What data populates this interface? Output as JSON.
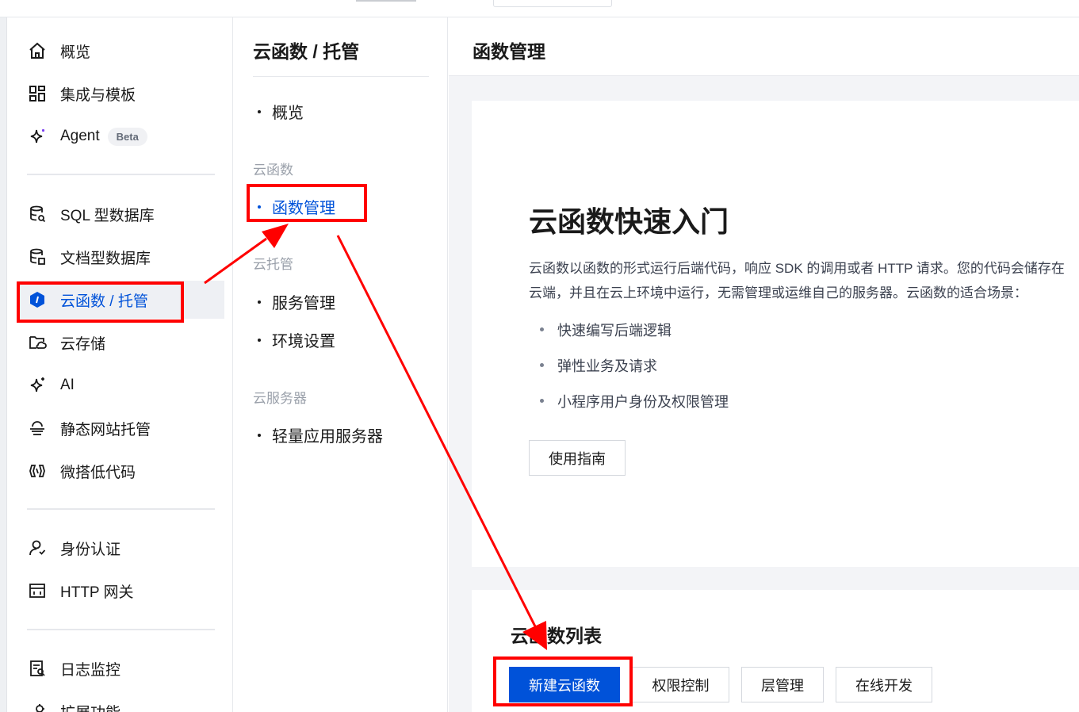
{
  "sidebar": {
    "items": [
      {
        "label": "概览",
        "icon": "home-icon"
      },
      {
        "label": "集成与模板",
        "icon": "grid-icon"
      },
      {
        "label": "Agent",
        "icon": "sparkle-icon",
        "badge": "Beta"
      },
      {
        "label": "SQL 型数据库",
        "icon": "sql-database-icon"
      },
      {
        "label": "文档型数据库",
        "icon": "document-database-icon"
      },
      {
        "label": "云函数 / 托管",
        "icon": "cloud-function-shield-icon",
        "active": true
      },
      {
        "label": "云存储",
        "icon": "cloud-storage-icon"
      },
      {
        "label": "AI",
        "icon": "ai-sparkle-icon"
      },
      {
        "label": "静态网站托管",
        "icon": "static-hosting-icon"
      },
      {
        "label": "微搭低代码",
        "icon": "lowcode-icon"
      },
      {
        "label": "身份认证",
        "icon": "user-auth-icon"
      },
      {
        "label": "HTTP 网关",
        "icon": "gateway-icon"
      },
      {
        "label": "日志监控",
        "icon": "log-monitor-icon"
      },
      {
        "label": "扩展功能",
        "icon": "extension-icon"
      }
    ]
  },
  "subnav": {
    "title": "云函数 / 托管",
    "overview": "概览",
    "group_functions": "云函数",
    "function_management": "函数管理",
    "group_hosting": "云托管",
    "service_management": "服务管理",
    "environment_settings": "环境设置",
    "group_servers": "云服务器",
    "lightweight_server": "轻量应用服务器"
  },
  "main": {
    "title": "函数管理",
    "hero_title": "云函数快速入门",
    "desc_line1": "云函数以函数的形式运行后端代码，响应 SDK 的调用或者 HTTP 请求。您的代码会储存在",
    "desc_line2": "云端，并且在云上环境中运行，无需管理或运维自己的服务器。云函数的适合场景：",
    "bullets": [
      "快速编写后端逻辑",
      "弹性业务及请求",
      "小程序用户身份及权限管理"
    ],
    "guide_button": "使用指南",
    "list_title": "云函数列表",
    "buttons": {
      "create": "新建云函数",
      "permission": "权限控制",
      "layer": "层管理",
      "online_dev": "在线开发"
    }
  },
  "colors": {
    "accent": "#0052d9",
    "annotation": "#ff0000"
  }
}
